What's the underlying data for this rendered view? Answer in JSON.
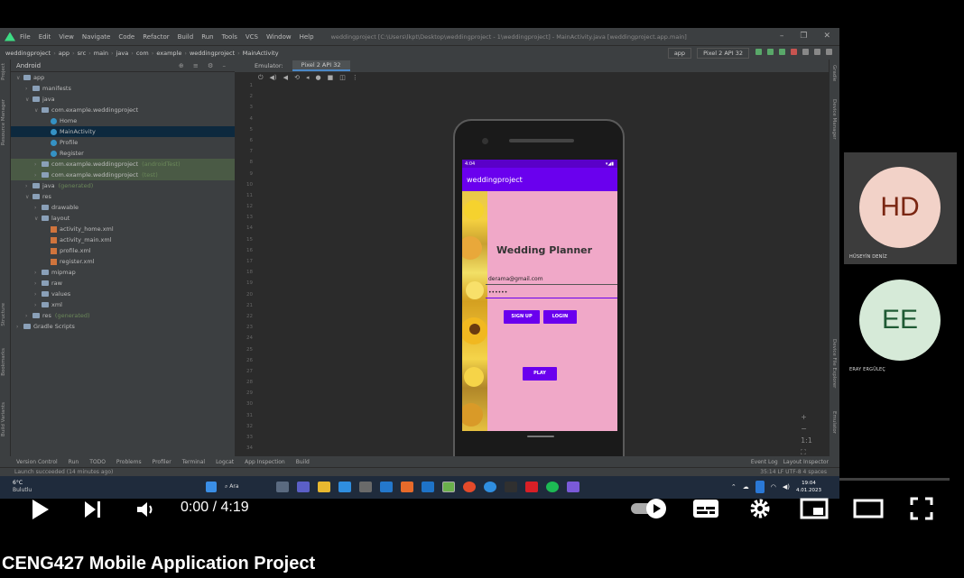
{
  "ide": {
    "menu": [
      "File",
      "Edit",
      "View",
      "Navigate",
      "Code",
      "Refactor",
      "Build",
      "Run",
      "Tools",
      "VCS",
      "Window",
      "Help"
    ],
    "window_title": "weddingproject [C:\\Users\\lkpt\\Desktop\\weddingproject - 1\\weddingproject] - MainActivity.java [weddingproject.app.main]",
    "breadcrumbs": [
      "weddingproject",
      "app",
      "src",
      "main",
      "java",
      "com",
      "example",
      "weddingproject",
      "MainActivity"
    ],
    "run_config": "app",
    "device": "Pixel 2 API 32",
    "project_view": "Android",
    "tree": [
      {
        "label": "app",
        "depth": 0,
        "type": "folder",
        "open": true
      },
      {
        "label": "manifests",
        "depth": 1,
        "type": "folder"
      },
      {
        "label": "java",
        "depth": 1,
        "type": "folder",
        "open": true
      },
      {
        "label": "com.example.weddingproject",
        "depth": 2,
        "type": "folder",
        "open": true
      },
      {
        "label": "Home",
        "depth": 3,
        "type": "class"
      },
      {
        "label": "MainActivity",
        "depth": 3,
        "type": "class",
        "selected": true
      },
      {
        "label": "Profile",
        "depth": 3,
        "type": "class"
      },
      {
        "label": "Register",
        "depth": 3,
        "type": "class"
      },
      {
        "label": "com.example.weddingproject",
        "suffix": "(androidTest)",
        "depth": 2,
        "type": "folder",
        "highlight": true
      },
      {
        "label": "com.example.weddingproject",
        "suffix": "(test)",
        "depth": 2,
        "type": "folder",
        "highlight": true
      },
      {
        "label": "java",
        "suffix": "(generated)",
        "depth": 1,
        "type": "folder"
      },
      {
        "label": "res",
        "depth": 1,
        "type": "folder",
        "open": true
      },
      {
        "label": "drawable",
        "depth": 2,
        "type": "folder"
      },
      {
        "label": "layout",
        "depth": 2,
        "type": "folder",
        "open": true
      },
      {
        "label": "activity_home.xml",
        "depth": 3,
        "type": "xml"
      },
      {
        "label": "activity_main.xml",
        "depth": 3,
        "type": "xml"
      },
      {
        "label": "profile.xml",
        "depth": 3,
        "type": "xml"
      },
      {
        "label": "register.xml",
        "depth": 3,
        "type": "xml"
      },
      {
        "label": "mipmap",
        "depth": 2,
        "type": "folder"
      },
      {
        "label": "raw",
        "depth": 2,
        "type": "folder"
      },
      {
        "label": "values",
        "depth": 2,
        "type": "folder"
      },
      {
        "label": "xml",
        "depth": 2,
        "type": "folder"
      },
      {
        "label": "res",
        "suffix": "(generated)",
        "depth": 1,
        "type": "folder"
      },
      {
        "label": "Gradle Scripts",
        "depth": 0,
        "type": "folder"
      }
    ],
    "left_strip": [
      "Project",
      "Resource Manager",
      "Structure",
      "Bookmarks",
      "Build Variants"
    ],
    "right_strip": [
      "Gradle",
      "Device Manager",
      "Device File Explorer",
      "Emulator"
    ],
    "emulator_label": "Emulator:",
    "emulator_tab": "Pixel 2 API 32",
    "line_numbers": [
      "1",
      "2",
      "3",
      "4",
      "5",
      "6",
      "7",
      "8",
      "9",
      "10",
      "11",
      "12",
      "13",
      "14",
      "15",
      "16",
      "17",
      "18",
      "19",
      "20",
      "21",
      "22",
      "23",
      "24",
      "25",
      "26",
      "27",
      "28",
      "29",
      "30",
      "31",
      "32",
      "33",
      "34"
    ],
    "zoom": "1:1",
    "tool_windows": [
      "Version Control",
      "Run",
      "TODO",
      "Problems",
      "Profiler",
      "Terminal",
      "Logcat",
      "App Inspection",
      "Build"
    ],
    "tool_windows_right": [
      "Event Log",
      "Layout Inspector"
    ],
    "status_left": "Launch succeeded (14 minutes ago)",
    "status_right": "35:14   LF   UTF-8   4 spaces"
  },
  "app": {
    "status_time": "4:04",
    "status_icons": "▾◢▮",
    "app_title": "weddingproject",
    "heading": "Wedding Planner",
    "email_value": "derama@gmail.com",
    "password_value": "••••••",
    "signup_label": "SIGN UP",
    "login_label": "LOGIN",
    "play_label": "PLAY"
  },
  "taskbar": {
    "temp": "6°C",
    "weather": "Bulutlu",
    "search": "Ara",
    "time": "19:04",
    "date": "4.01.2023"
  },
  "participants": [
    {
      "initials": "HD",
      "name": "HÜSEYİN DENİZ",
      "bg": "#f2d2c8",
      "fg": "#7a2612"
    },
    {
      "initials": "EE",
      "name": "ERAY ERGÜLEÇ",
      "bg": "#d6ead8",
      "fg": "#1f5a34"
    }
  ],
  "player": {
    "time": "0:00 / 4:19",
    "progress": 0.0,
    "buffered": 0.48
  },
  "video_title": "CENG427 Mobile Application Project",
  "colors": {
    "accent": "#6a00ee",
    "screen_bg": "#f0a8c8",
    "progress_red": "#ff0000"
  }
}
